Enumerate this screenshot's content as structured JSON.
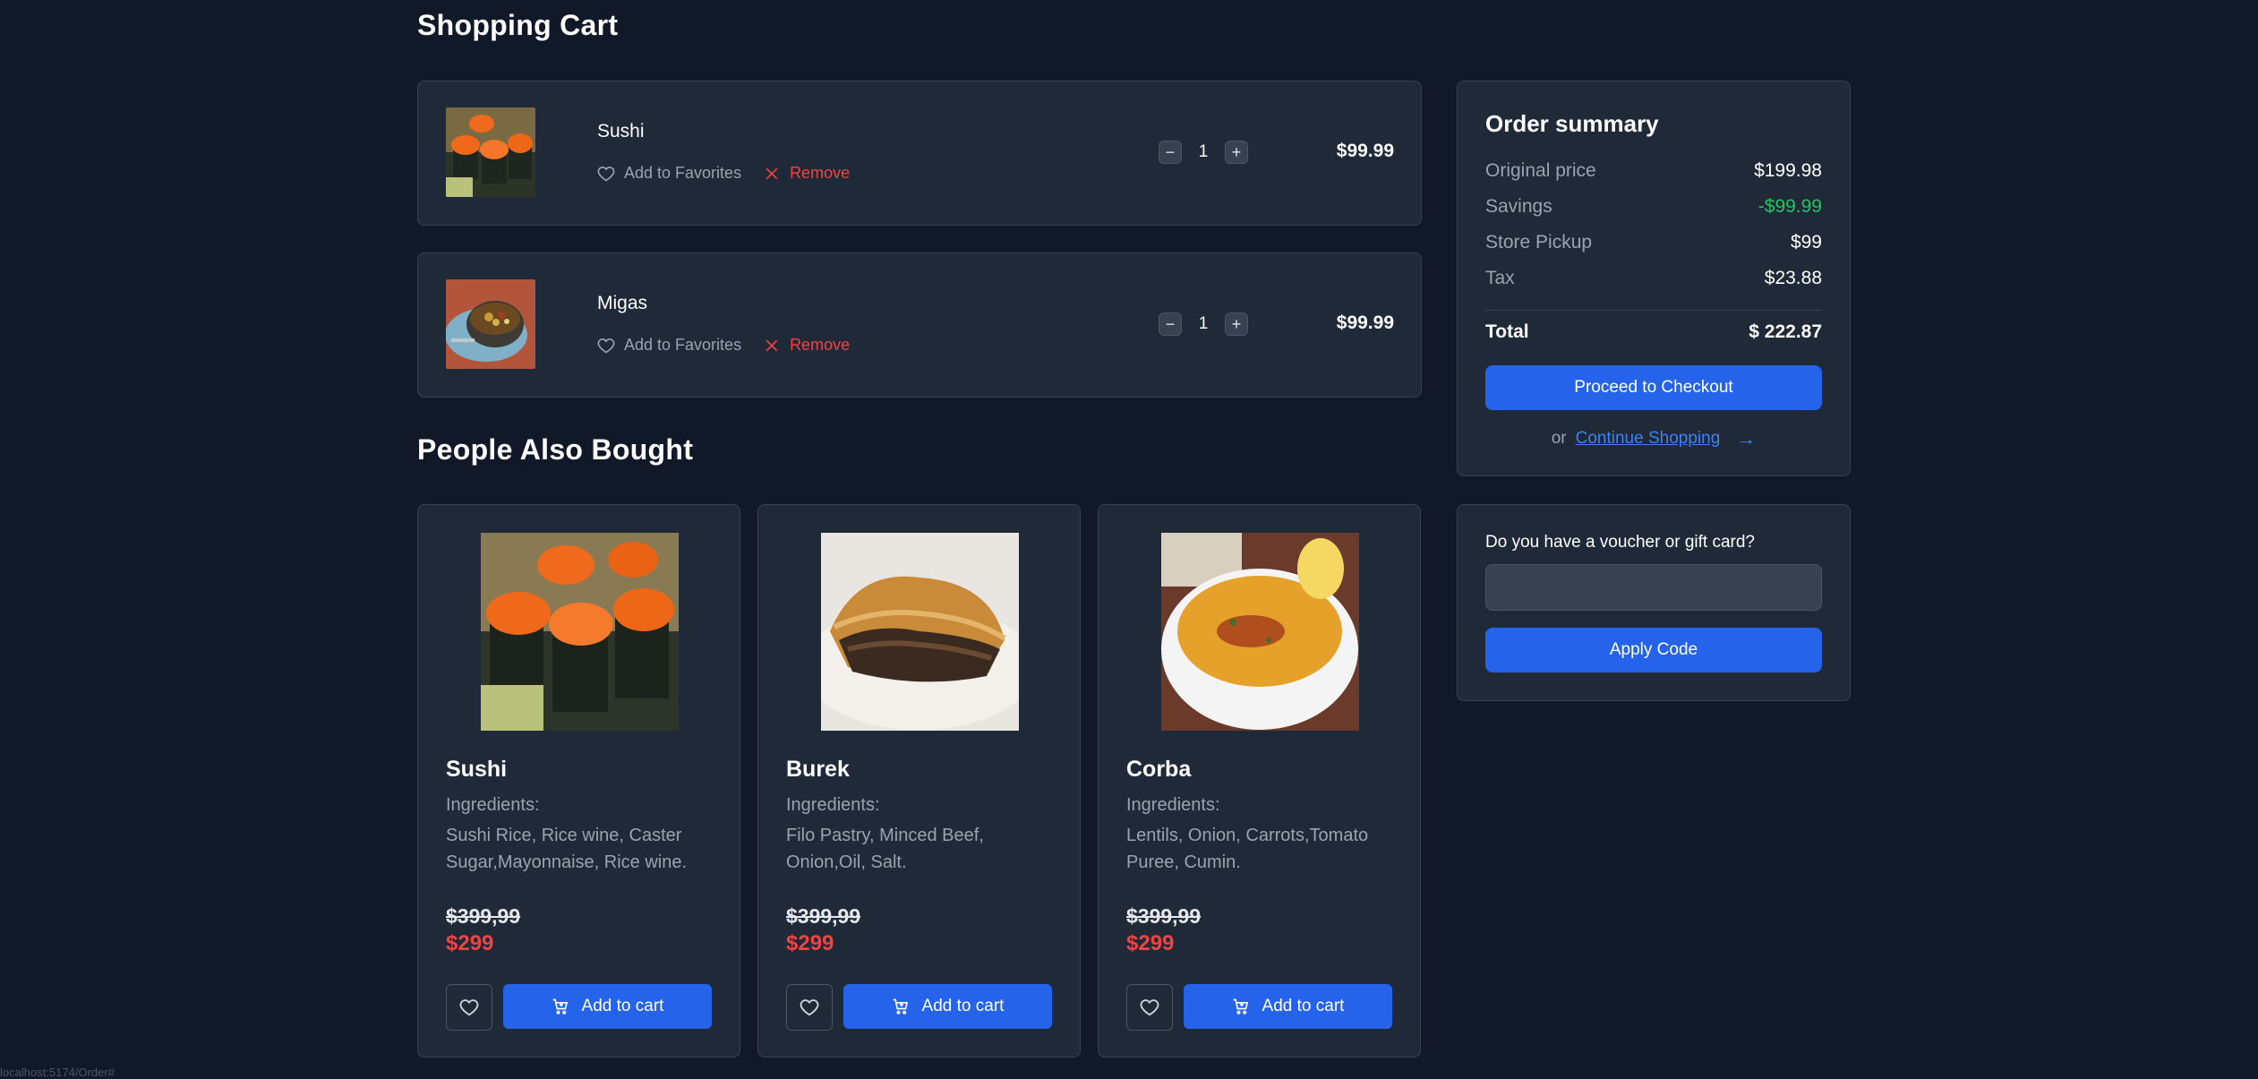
{
  "page": {
    "title": "Shopping Cart",
    "also_bought_title": "People Also Bought"
  },
  "cart": {
    "items": [
      {
        "name": "Sushi",
        "quantity": "1",
        "price": "$99.99",
        "favorite_label": "Add to Favorites",
        "remove_label": "Remove",
        "image": "sushi"
      },
      {
        "name": "Migas",
        "quantity": "1",
        "price": "$99.99",
        "favorite_label": "Add to Favorites",
        "remove_label": "Remove",
        "image": "migas"
      }
    ],
    "minus_symbol": "−",
    "plus_symbol": "+"
  },
  "summary": {
    "title": "Order summary",
    "rows": [
      {
        "label": "Original price",
        "value": "$199.98"
      },
      {
        "label": "Savings",
        "value": "-$99.99"
      },
      {
        "label": "Store Pickup",
        "value": "$99"
      },
      {
        "label": "Tax",
        "value": "$23.88"
      }
    ],
    "total_label": "Total",
    "total_value": "$ 222.87",
    "checkout_label": "Proceed to Checkout",
    "or_text": "or",
    "continue_label": "Continue Shopping",
    "savings_color": "#22c55e"
  },
  "voucher": {
    "label": "Do you have a voucher or gift card?",
    "input_value": "",
    "apply_label": "Apply Code"
  },
  "products": [
    {
      "name": "Sushi",
      "ingredients_label": "Ingredients:",
      "ingredients": "Sushi Rice, Rice wine, Caster Sugar,Mayonnaise, Rice wine.",
      "old_price": "$399,99",
      "new_price": "$299",
      "add_label": "Add to cart",
      "image": "sushi"
    },
    {
      "name": "Burek",
      "ingredients_label": "Ingredients:",
      "ingredients": "Filo Pastry, Minced Beef, Onion,Oil, Salt.",
      "old_price": "$399,99",
      "new_price": "$299",
      "add_label": "Add to cart",
      "image": "burek"
    },
    {
      "name": "Corba",
      "ingredients_label": "Ingredients:",
      "ingredients": "Lentils, Onion, Carrots,Tomato Puree, Cumin.",
      "old_price": "$399,99",
      "new_price": "$299",
      "add_label": "Add to cart",
      "image": "corba"
    }
  ],
  "status_bar": "localhost:5174/Order#",
  "colors": {
    "background": "#111827",
    "card": "#1f2937",
    "accent": "#2563eb",
    "danger": "#ef4444",
    "link": "#3b82f6"
  }
}
